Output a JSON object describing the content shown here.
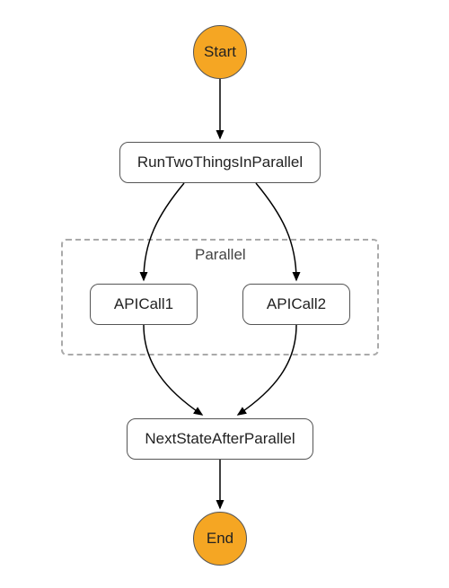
{
  "diagram": {
    "start": {
      "label": "Start"
    },
    "run_parallel": {
      "label": "RunTwoThingsInParallel"
    },
    "parallel_group": {
      "label": "Parallel"
    },
    "api1": {
      "label": "APICall1"
    },
    "api2": {
      "label": "APICall2"
    },
    "next_state": {
      "label": "NextStateAfterParallel"
    },
    "end": {
      "label": "End"
    },
    "colors": {
      "terminal_fill": "#f5a623",
      "stroke": "#555555",
      "dash": "#aaaaaa"
    }
  }
}
